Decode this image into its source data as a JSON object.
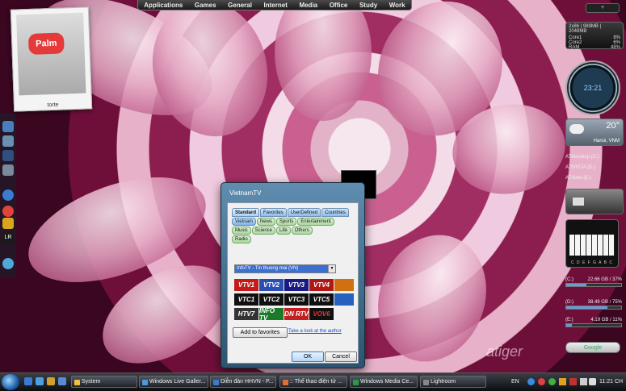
{
  "topbar": {
    "items": [
      "Applications",
      "Games",
      "General",
      "Internet",
      "Media",
      "Office",
      "Study",
      "Work"
    ]
  },
  "polaroid": {
    "logo": "Palm",
    "caption": "torte"
  },
  "sidebar": {
    "add_label": "+",
    "sysmon": {
      "title": "2x86 | 989MB | 2048MB",
      "rows": [
        {
          "label": "Core1",
          "value": "8%"
        },
        {
          "label": "Core2",
          "value": "6%"
        },
        {
          "label": "RAM",
          "value": "48%"
        }
      ]
    },
    "clock": {
      "time": "23:21"
    },
    "weather": {
      "temp": "20°",
      "place": "Hanoi, VNM"
    },
    "drives_top": [
      "ATIdesktop (C:)",
      "ATIVISTA (D:)",
      "ATIdata (E:)"
    ],
    "piano_notes": "C D E F G A B C",
    "drives": [
      {
        "label": "(C:)",
        "info": "22.66 GB / 37%",
        "fill": 0.37
      },
      {
        "label": "(D:)",
        "info": "38.49 GB / 75%",
        "fill": 0.75
      },
      {
        "label": "(E:)",
        "info": "4.19 GB / 11%",
        "fill": 0.11
      }
    ],
    "search": "Google"
  },
  "dialog": {
    "title": "VietnamTV",
    "tabs": [
      "Standard",
      "Favorites",
      "UserDefined",
      "Countries"
    ],
    "subtabs_row1": [
      "Vietnam",
      "News",
      "Sports",
      "Entertainment"
    ],
    "subtabs_row2": [
      "Music",
      "Science",
      "Life",
      "Others"
    ],
    "subtabs_row3": [
      "Radio"
    ],
    "selected_channel": "InfoTV - Tin thuong mai (VN)",
    "logos": [
      "VTV1",
      "VTV2",
      "VTV3",
      "VTV4",
      "VTC1",
      "VTC2",
      "VTC3",
      "VTC5",
      "HTV7",
      "INFO TV",
      "DN RTV",
      "VOV6"
    ],
    "add_favorites": "Add to favorites",
    "link": "Take a look at the author",
    "ok": "OK",
    "cancel": "Cancel"
  },
  "watermark": "atiger",
  "taskbar": {
    "buttons": [
      "System",
      "Windows Live Galler...",
      "Diễn đàn HHVN - P...",
      ":: Thế thao điện tử ...",
      "Windows Media Ce...",
      "Lightroom"
    ],
    "lang": "EN",
    "clock": "11:21 CH"
  }
}
